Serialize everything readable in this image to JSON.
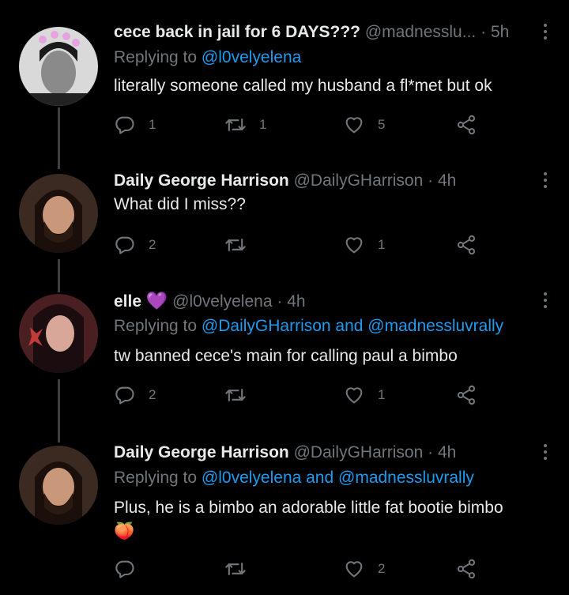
{
  "tweets": [
    {
      "name": "cece back in jail for 6 DAYS???",
      "handle": "@madnesslu...",
      "time": "5h",
      "replying_label": "Replying to",
      "replying_to": "@l0velyelena",
      "text": "literally someone called my husband a fl*met but ok",
      "replies": "1",
      "retweets": "1",
      "likes": "5"
    },
    {
      "name": "Daily George Harrison",
      "handle": "@DailyGHarrison",
      "time": "4h",
      "text": "What did I miss??",
      "replies": "2",
      "retweets": "",
      "likes": "1"
    },
    {
      "name": "elle",
      "name_emoji": "💜",
      "handle": "@l0velyelena",
      "time": "4h",
      "replying_label": "Replying to",
      "replying_to": "@DailyGHarrison and @madnessluvrally",
      "text": "tw banned cece's main for calling paul a bimbo",
      "replies": "2",
      "retweets": "",
      "likes": "1"
    },
    {
      "name": "Daily George Harrison",
      "handle": "@DailyGHarrison",
      "time": "4h",
      "replying_label": "Replying to",
      "replying_to": "@l0velyelena and @madnessluvrally",
      "text": "Plus, he is a bimbo an adorable little fat bootie bimbo",
      "text_emoji": "🍑",
      "replies": "",
      "retweets": "",
      "likes": "2"
    }
  ],
  "separator": "·",
  "colors": {
    "accent": "#1d9bf0",
    "muted": "#71767b",
    "text": "#e7e9ea",
    "bg": "#000000"
  }
}
